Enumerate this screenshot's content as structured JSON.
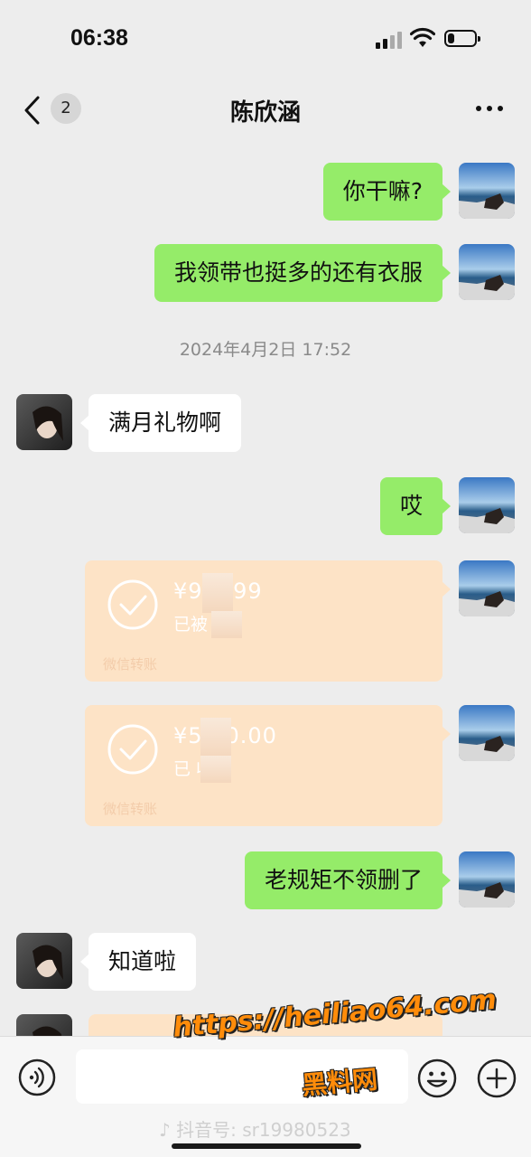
{
  "status_bar": {
    "time": "06:38",
    "battery_level": 0.25
  },
  "nav": {
    "unread_count": "2",
    "title": "陈欣涵"
  },
  "messages": [
    {
      "side": "out",
      "text": "你干嘛?"
    },
    {
      "side": "out",
      "text": "我领带也挺多的还有衣服"
    },
    {
      "side": "in",
      "text": "满月礼物啊"
    },
    {
      "side": "out",
      "text": "哎"
    },
    {
      "side": "out",
      "text": "老规矩不领删了"
    },
    {
      "side": "in",
      "text": "知道啦"
    }
  ],
  "timestamp": "2024年4月2日 17:52",
  "transfers": [
    {
      "amount": "¥9      9.99",
      "status": "已被    攻",
      "label": "微信转账"
    },
    {
      "amount": "¥5      00.00",
      "status": "已    收",
      "label": "微信转账"
    }
  ],
  "watermark": {
    "line1": "https://heiliao64.com",
    "line2": "黑料网"
  },
  "douyin": {
    "text": "抖音号: sr19980523"
  },
  "colors": {
    "out_bubble": "#95ec69",
    "in_bubble": "#ffffff",
    "transfer": "#fde3c6",
    "background": "#ededed"
  }
}
